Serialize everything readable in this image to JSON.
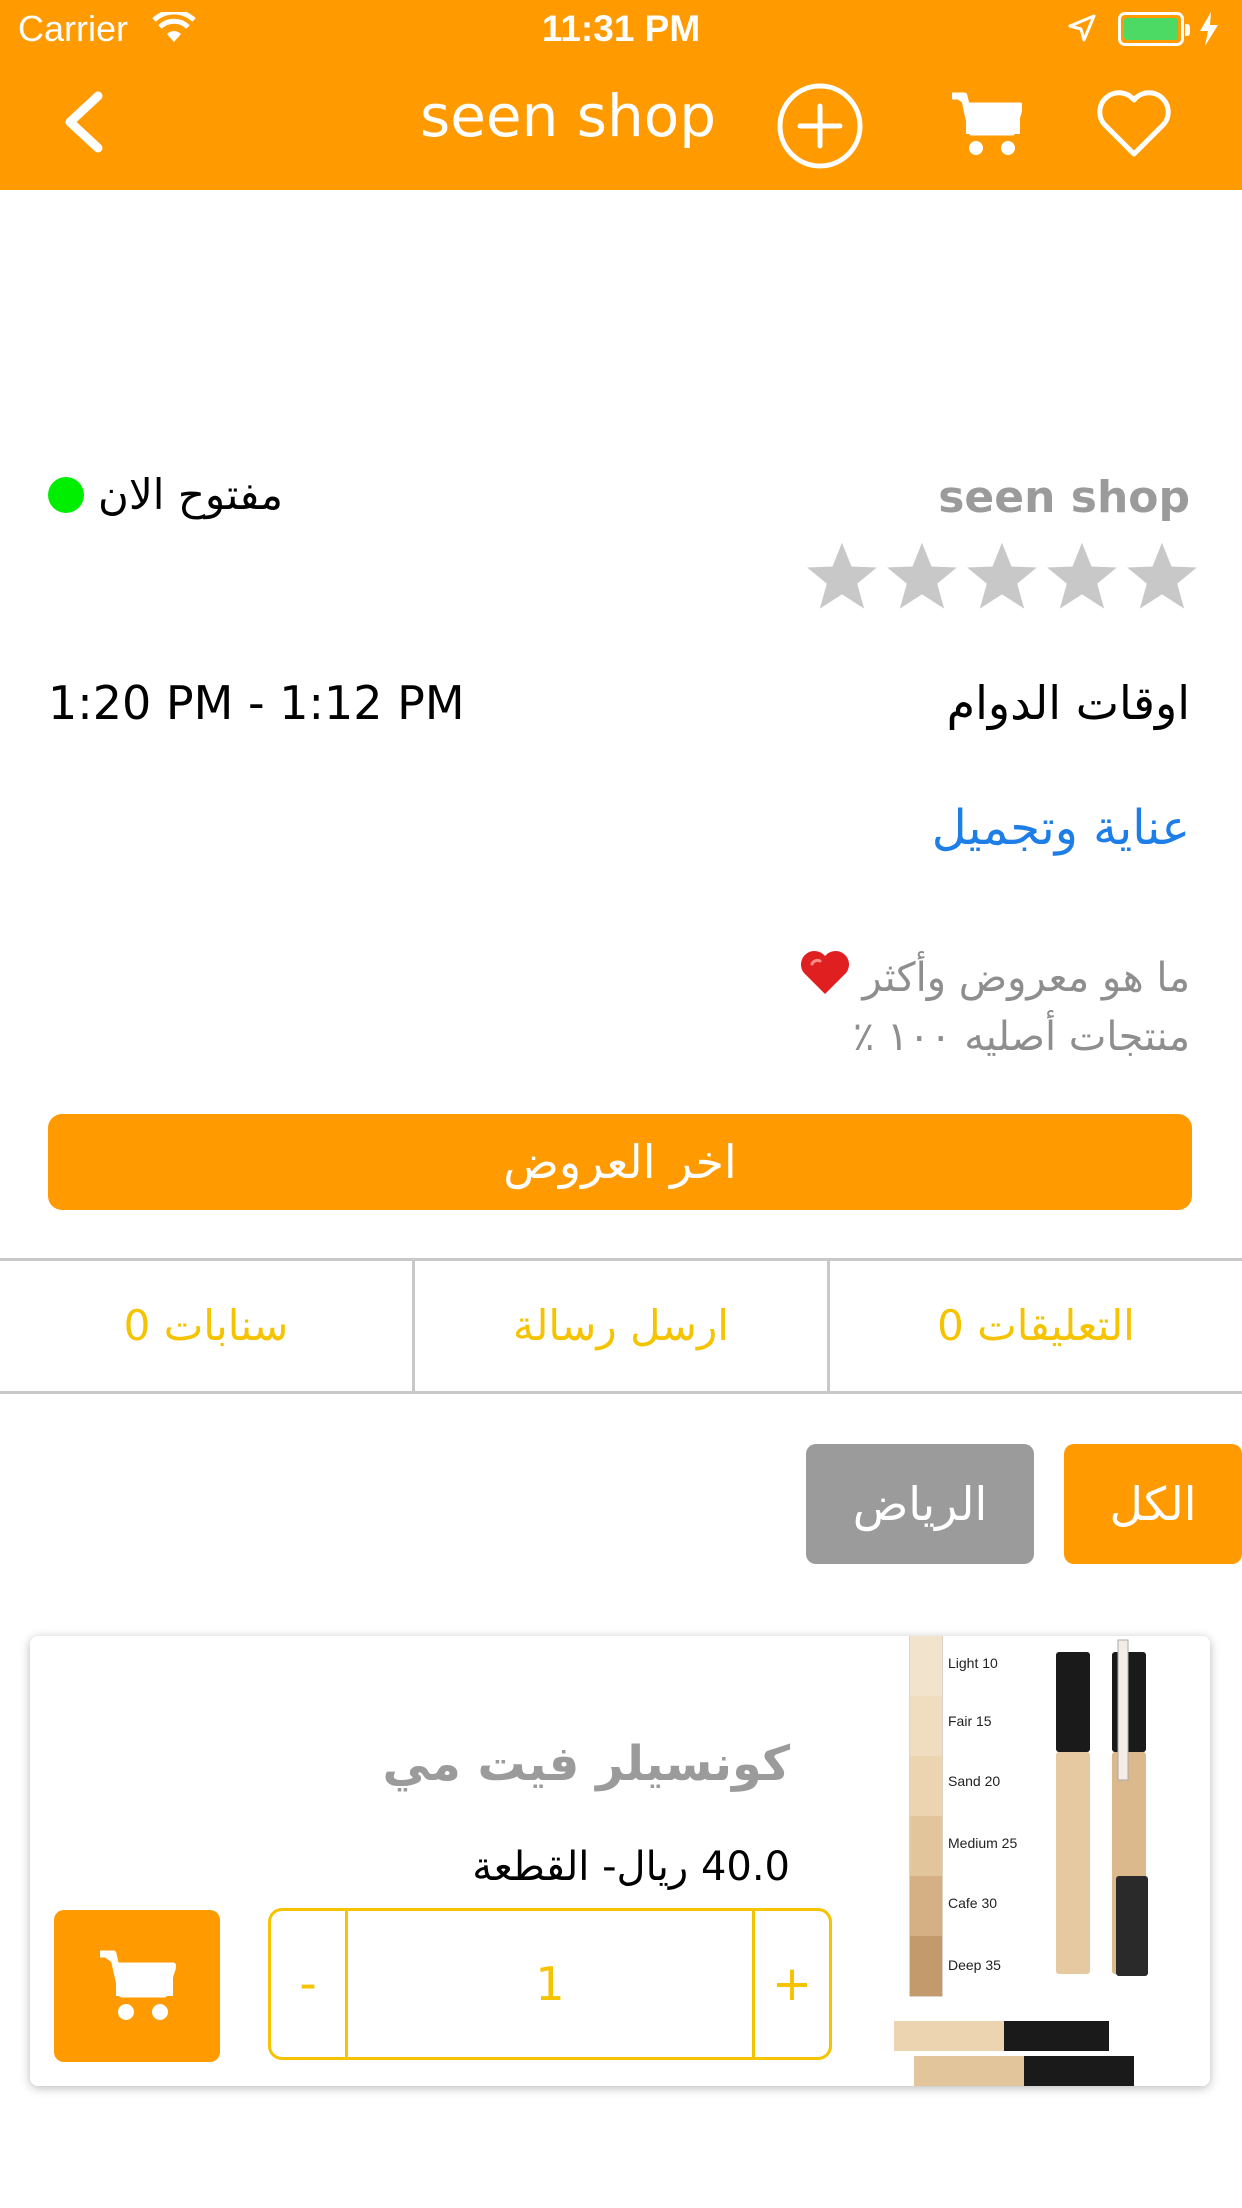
{
  "status_bar": {
    "carrier": "Carrier",
    "time": "11:31 PM"
  },
  "nav": {
    "title": "seen shop",
    "icons": [
      "back-chevron-icon",
      "add-circle-icon",
      "cart-icon",
      "heart-icon"
    ]
  },
  "shop": {
    "name": "seen shop",
    "rating": 0,
    "rating_max": 5,
    "open_status": "مفتوح الان",
    "open_color": "#00EE00",
    "hours_label": "اوقات الدوام",
    "hours_value": "1:20 PM - 1:12 PM",
    "category": "عناية وتجميل",
    "description_line1": "ما هو معروض وأكثر",
    "description_emoji": "❤️",
    "description_line2": "منتجات أصليه ١٠٠ ٪"
  },
  "offers_button": "اخر العروض",
  "stats": {
    "comments": "0 التعليقات",
    "send_message": "ارسل رسالة",
    "snapchat": "0 سنابات"
  },
  "filters": {
    "all": "الكل",
    "city": "الرياض"
  },
  "product": {
    "name": "كونسيلر فيت مي",
    "price": "40.0 ريال- القطعة",
    "quantity": "1",
    "minus": "-",
    "plus": "+",
    "image_swatches": [
      "Light 10",
      "Fair 15",
      "Sand 20",
      "Medium 25",
      "Cafe 30",
      "Deep 35"
    ]
  },
  "colors": {
    "primary": "#FF9A00",
    "accent_yellow": "#F5C300",
    "link_blue": "#1E7EE8",
    "muted_gray": "#9b9b9b"
  }
}
